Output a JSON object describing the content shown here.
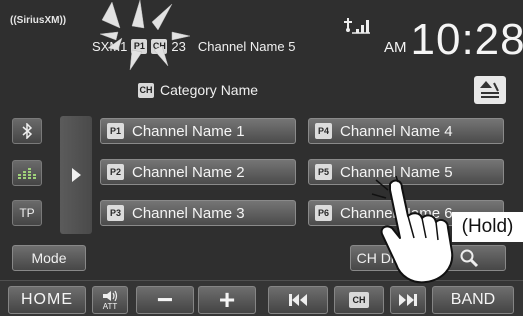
{
  "header": {
    "logo_text": "((SiriusXM))",
    "band": "SXM1",
    "preset_chip": "P1",
    "ch_chip": "CH",
    "channel_number": "23",
    "channel_name": "Channel Name 5",
    "ampm": "AM",
    "time": "10:28",
    "category": "Category Name",
    "category_chip": "CH"
  },
  "side": {
    "bluetooth_icon": "bluetooth-icon",
    "eq_icon": "equalizer-icon",
    "tp_label": "TP",
    "expand_icon": "play-right-icon"
  },
  "presets": [
    {
      "num": "P1",
      "label": "Channel Name 1"
    },
    {
      "num": "P2",
      "label": "Channel Name 2"
    },
    {
      "num": "P3",
      "label": "Channel Name 3"
    },
    {
      "num": "P4",
      "label": "Channel Name 4"
    },
    {
      "num": "P5",
      "label": "Channel Name 5"
    },
    {
      "num": "P6",
      "label": "Channel Name 6"
    }
  ],
  "controls": {
    "mode_label": "Mode",
    "ch_direct_label": "CH Direct",
    "search_icon": "search-icon"
  },
  "bottom": {
    "home_label": "HOME",
    "att_label": "ATT",
    "minus": "−",
    "plus": "+",
    "prev_icon": "skip-back-icon",
    "ch_label": "CH",
    "next_icon": "skip-forward-icon",
    "band_label": "BAND"
  },
  "annotation": {
    "hold_label": "(Hold)"
  },
  "colors": {
    "screen_bg": "#2f2f2f",
    "button_top": "#757575",
    "button_bottom": "#4b4b4b",
    "text": "#f4f4f4"
  }
}
